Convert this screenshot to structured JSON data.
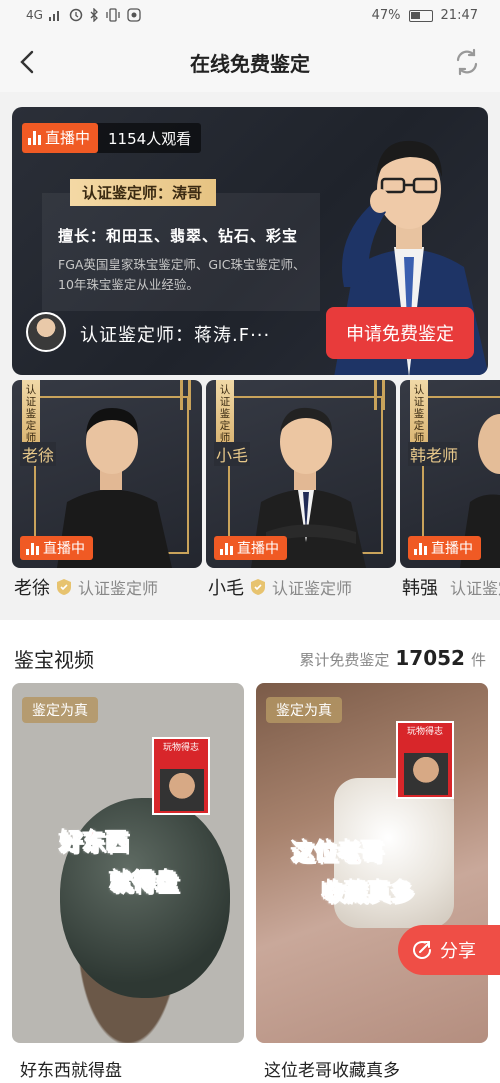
{
  "status_bar": {
    "signal": "4G",
    "battery": "47%",
    "time": "21:47"
  },
  "header": {
    "title": "在线免费鉴定"
  },
  "hero": {
    "live_label": "直播中",
    "viewers": "1154人观看",
    "cert_title": "认证鉴定师：涛哥",
    "specialty": "擅长：和田玉、翡翠、钻石、彩宝",
    "description": "FGA英国皇家珠宝鉴定师、GIC珠宝鉴定师、10年珠宝鉴定从业经验。",
    "expert_name": "认证鉴定师：蒋涛.F···",
    "apply_label": "申请免费鉴定"
  },
  "experts": [
    {
      "overlay": "老徐",
      "name": "老徐",
      "badge_label": "认证鉴定师",
      "live_label": "直播中",
      "vertical_label": "认证鉴定师"
    },
    {
      "overlay": "小毛",
      "name": "小毛",
      "badge_label": "认证鉴定师",
      "live_label": "直播中",
      "vertical_label": "认证鉴定师"
    },
    {
      "overlay": "韩老师",
      "name": "韩强",
      "badge_label": "认证鉴定师",
      "live_label": "直播中",
      "vertical_label": "认证鉴定师"
    }
  ],
  "videos_section": {
    "title": "鉴宝视频",
    "count_label": "累计免费鉴定",
    "count": "17052",
    "count_unit": "件",
    "videos": [
      {
        "tag": "鉴定为真",
        "caption_line1": "好东西",
        "caption_line2": "就得盘",
        "title": "好东西就得盘",
        "thumb_label": "玩物得志"
      },
      {
        "tag": "鉴定为真",
        "caption_line1": "这位老哥",
        "caption_line2": "收藏真多",
        "title": "这位老哥收藏真多",
        "thumb_label": "玩物得志"
      }
    ]
  },
  "share": {
    "label": "分享"
  },
  "colors": {
    "accent_red": "#e83b3b",
    "live_orange": "#f05a24",
    "gold": "#c9a35b"
  }
}
